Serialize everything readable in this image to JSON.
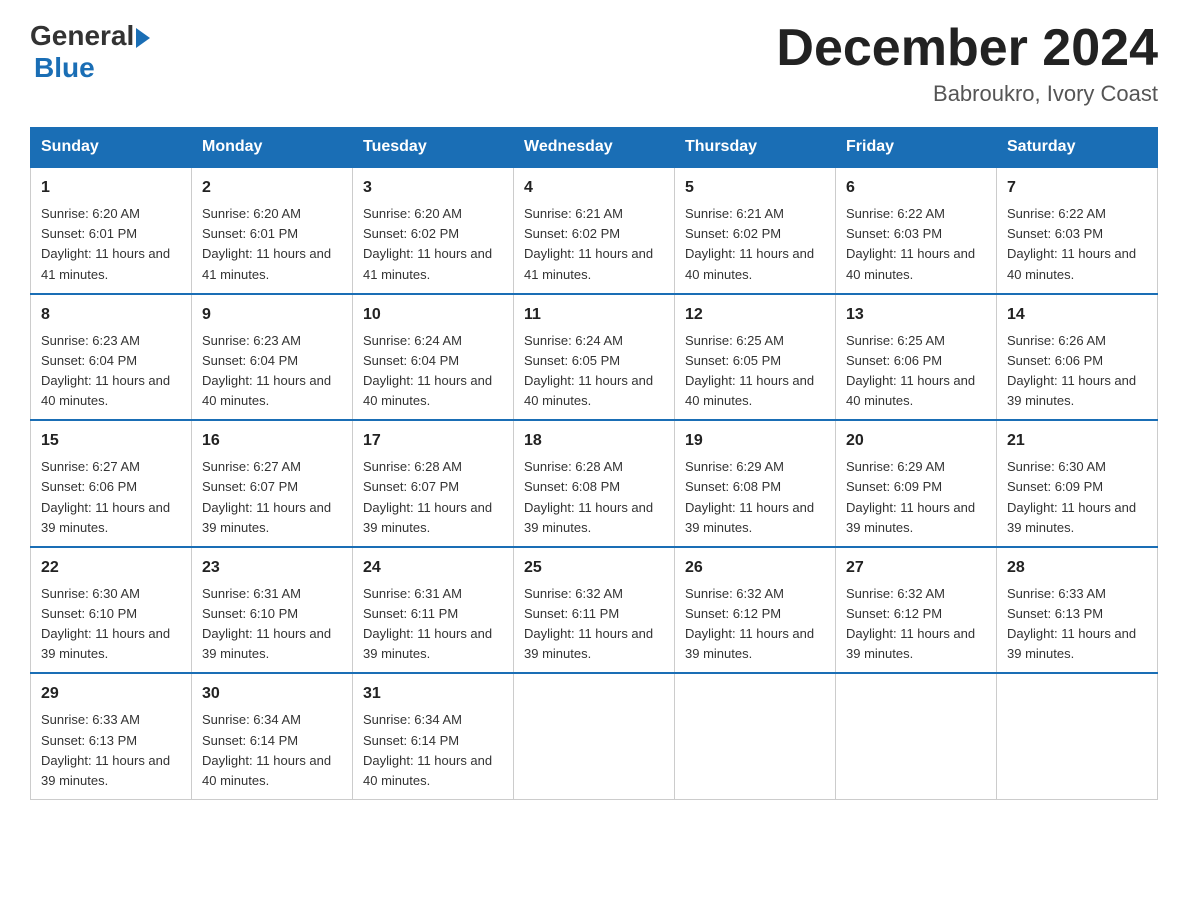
{
  "header": {
    "logo_general": "General",
    "logo_blue": "Blue",
    "month_title": "December 2024",
    "location": "Babroukro, Ivory Coast"
  },
  "days_of_week": [
    "Sunday",
    "Monday",
    "Tuesday",
    "Wednesday",
    "Thursday",
    "Friday",
    "Saturday"
  ],
  "weeks": [
    [
      {
        "day": "1",
        "sunrise": "6:20 AM",
        "sunset": "6:01 PM",
        "daylight": "11 hours and 41 minutes."
      },
      {
        "day": "2",
        "sunrise": "6:20 AM",
        "sunset": "6:01 PM",
        "daylight": "11 hours and 41 minutes."
      },
      {
        "day": "3",
        "sunrise": "6:20 AM",
        "sunset": "6:02 PM",
        "daylight": "11 hours and 41 minutes."
      },
      {
        "day": "4",
        "sunrise": "6:21 AM",
        "sunset": "6:02 PM",
        "daylight": "11 hours and 41 minutes."
      },
      {
        "day": "5",
        "sunrise": "6:21 AM",
        "sunset": "6:02 PM",
        "daylight": "11 hours and 40 minutes."
      },
      {
        "day": "6",
        "sunrise": "6:22 AM",
        "sunset": "6:03 PM",
        "daylight": "11 hours and 40 minutes."
      },
      {
        "day": "7",
        "sunrise": "6:22 AM",
        "sunset": "6:03 PM",
        "daylight": "11 hours and 40 minutes."
      }
    ],
    [
      {
        "day": "8",
        "sunrise": "6:23 AM",
        "sunset": "6:04 PM",
        "daylight": "11 hours and 40 minutes."
      },
      {
        "day": "9",
        "sunrise": "6:23 AM",
        "sunset": "6:04 PM",
        "daylight": "11 hours and 40 minutes."
      },
      {
        "day": "10",
        "sunrise": "6:24 AM",
        "sunset": "6:04 PM",
        "daylight": "11 hours and 40 minutes."
      },
      {
        "day": "11",
        "sunrise": "6:24 AM",
        "sunset": "6:05 PM",
        "daylight": "11 hours and 40 minutes."
      },
      {
        "day": "12",
        "sunrise": "6:25 AM",
        "sunset": "6:05 PM",
        "daylight": "11 hours and 40 minutes."
      },
      {
        "day": "13",
        "sunrise": "6:25 AM",
        "sunset": "6:06 PM",
        "daylight": "11 hours and 40 minutes."
      },
      {
        "day": "14",
        "sunrise": "6:26 AM",
        "sunset": "6:06 PM",
        "daylight": "11 hours and 39 minutes."
      }
    ],
    [
      {
        "day": "15",
        "sunrise": "6:27 AM",
        "sunset": "6:06 PM",
        "daylight": "11 hours and 39 minutes."
      },
      {
        "day": "16",
        "sunrise": "6:27 AM",
        "sunset": "6:07 PM",
        "daylight": "11 hours and 39 minutes."
      },
      {
        "day": "17",
        "sunrise": "6:28 AM",
        "sunset": "6:07 PM",
        "daylight": "11 hours and 39 minutes."
      },
      {
        "day": "18",
        "sunrise": "6:28 AM",
        "sunset": "6:08 PM",
        "daylight": "11 hours and 39 minutes."
      },
      {
        "day": "19",
        "sunrise": "6:29 AM",
        "sunset": "6:08 PM",
        "daylight": "11 hours and 39 minutes."
      },
      {
        "day": "20",
        "sunrise": "6:29 AM",
        "sunset": "6:09 PM",
        "daylight": "11 hours and 39 minutes."
      },
      {
        "day": "21",
        "sunrise": "6:30 AM",
        "sunset": "6:09 PM",
        "daylight": "11 hours and 39 minutes."
      }
    ],
    [
      {
        "day": "22",
        "sunrise": "6:30 AM",
        "sunset": "6:10 PM",
        "daylight": "11 hours and 39 minutes."
      },
      {
        "day": "23",
        "sunrise": "6:31 AM",
        "sunset": "6:10 PM",
        "daylight": "11 hours and 39 minutes."
      },
      {
        "day": "24",
        "sunrise": "6:31 AM",
        "sunset": "6:11 PM",
        "daylight": "11 hours and 39 minutes."
      },
      {
        "day": "25",
        "sunrise": "6:32 AM",
        "sunset": "6:11 PM",
        "daylight": "11 hours and 39 minutes."
      },
      {
        "day": "26",
        "sunrise": "6:32 AM",
        "sunset": "6:12 PM",
        "daylight": "11 hours and 39 minutes."
      },
      {
        "day": "27",
        "sunrise": "6:32 AM",
        "sunset": "6:12 PM",
        "daylight": "11 hours and 39 minutes."
      },
      {
        "day": "28",
        "sunrise": "6:33 AM",
        "sunset": "6:13 PM",
        "daylight": "11 hours and 39 minutes."
      }
    ],
    [
      {
        "day": "29",
        "sunrise": "6:33 AM",
        "sunset": "6:13 PM",
        "daylight": "11 hours and 39 minutes."
      },
      {
        "day": "30",
        "sunrise": "6:34 AM",
        "sunset": "6:14 PM",
        "daylight": "11 hours and 40 minutes."
      },
      {
        "day": "31",
        "sunrise": "6:34 AM",
        "sunset": "6:14 PM",
        "daylight": "11 hours and 40 minutes."
      },
      null,
      null,
      null,
      null
    ]
  ],
  "labels": {
    "sunrise_prefix": "Sunrise: ",
    "sunset_prefix": "Sunset: ",
    "daylight_prefix": "Daylight: "
  }
}
